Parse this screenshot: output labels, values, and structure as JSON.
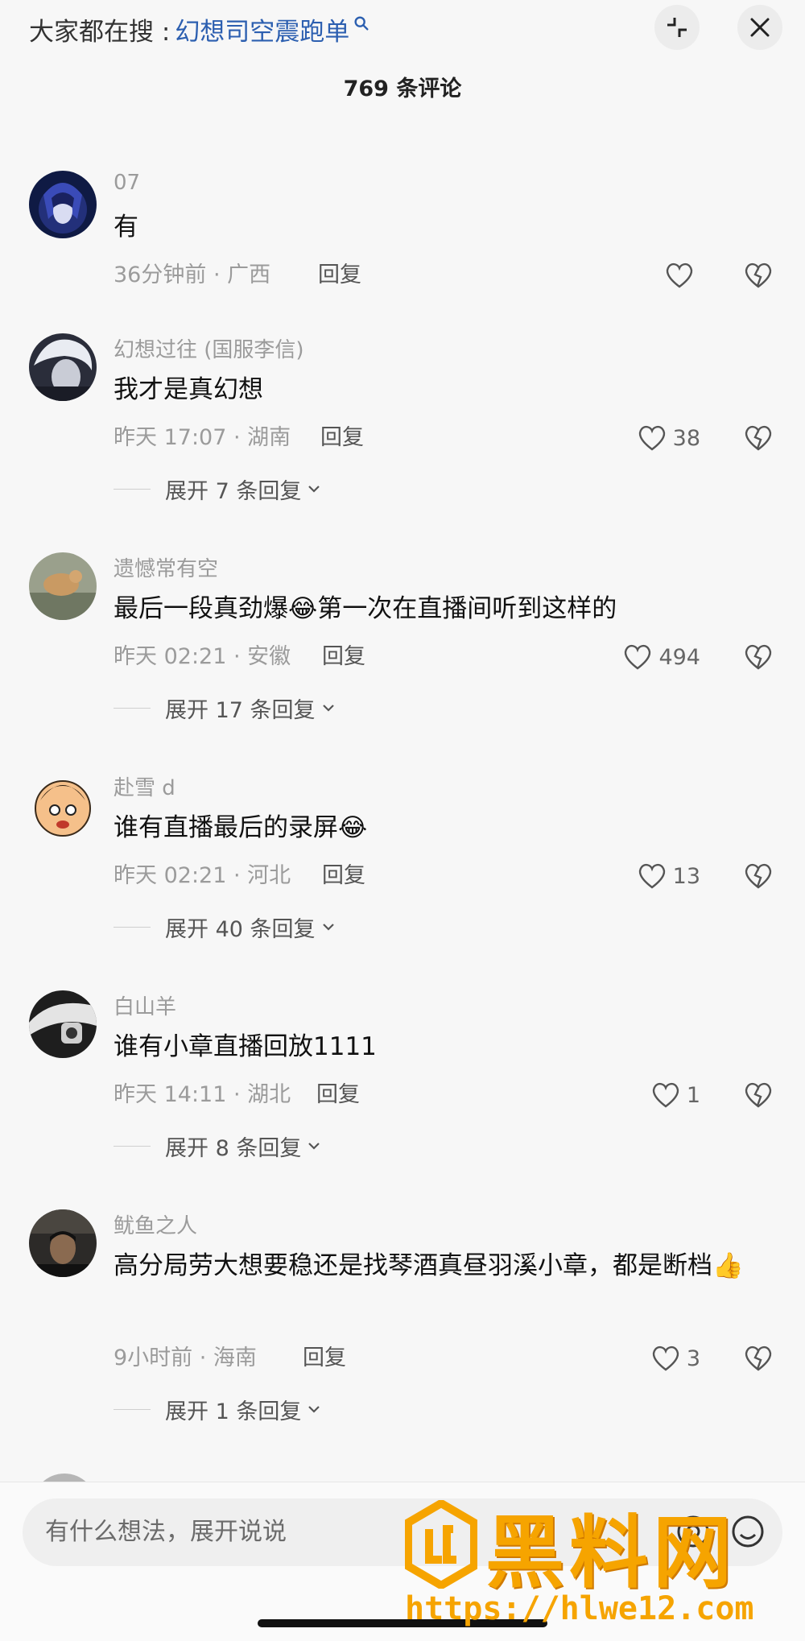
{
  "header": {
    "search_prefix": "大家都在搜 :",
    "search_keyword": "幻想司空震跑单",
    "collapse_icon": "collapse-icon",
    "close_icon": "close-icon"
  },
  "comment_count": "769 条评论",
  "comments": [
    {
      "username": "07",
      "text": "有",
      "time_location": "36分钟前 · 广西",
      "reply_label": "回复",
      "likes": "",
      "expand": ""
    },
    {
      "username": "幻想过往 (国服李信)",
      "text": "我才是真幻想",
      "time_location": "昨天 17:07 · 湖南",
      "reply_label": "回复",
      "likes": "38",
      "expand": "展开 7 条回复"
    },
    {
      "username": "遗憾常有空",
      "text": "最后一段真劲爆😂第一次在直播间听到这样的",
      "time_location": "昨天 02:21 · 安徽",
      "reply_label": "回复",
      "likes": "494",
      "expand": "展开 17 条回复"
    },
    {
      "username": "赴雪 d",
      "text": "谁有直播最后的录屏😂",
      "time_location": "昨天 02:21 · 河北",
      "reply_label": "回复",
      "likes": "13",
      "expand": "展开 40 条回复"
    },
    {
      "username": "白山羊",
      "text": "谁有小章直播回放1111",
      "time_location": "昨天 14:11 · 湖北",
      "reply_label": "回复",
      "likes": "1",
      "expand": "展开 8 条回复"
    },
    {
      "username": "鱿鱼之人",
      "text": "高分局劳大想要稳还是找琴酒真昼羽溪小章，都是断档👍",
      "time_location": "9小时前 · 海南",
      "reply_label": "回复",
      "likes": "3",
      "expand": "展开 1 条回复"
    }
  ],
  "input": {
    "placeholder": "有什么想法，展开说说"
  },
  "watermark": {
    "title": "黑料网",
    "url": "https://hlwe12.com"
  },
  "colors": {
    "accent_link": "#2c5fb0",
    "watermark": "#f6a400"
  }
}
